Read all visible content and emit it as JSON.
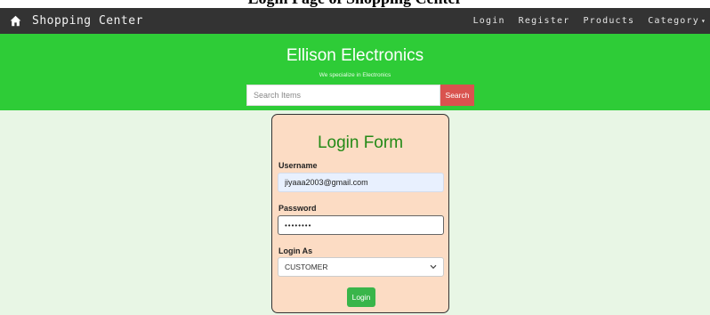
{
  "caption": {
    "text": "Login Page of Shopping Center"
  },
  "navbar": {
    "brand": "Shopping Center",
    "brand_icon": "home-icon",
    "links": [
      "Login",
      "Register",
      "Products",
      "Category"
    ],
    "dropdown_caret": "▾",
    "background": "#333333"
  },
  "header": {
    "title": "Ellison Electronics",
    "subtitle": "We specialize in Electronics",
    "background": "#2ecc37"
  },
  "search": {
    "placeholder": "Search Items",
    "button_label": "Search",
    "button_color": "#d9534f"
  },
  "login_form": {
    "title": "Login Form",
    "title_color": "#248a17",
    "card_background": "#fcdcc4",
    "username_label": "Username",
    "username_value": "jiyaaa2003@gmail.com",
    "password_label": "Password",
    "password_value": "••••••••",
    "role_label": "Login As",
    "role_value": "CUSTOMER",
    "submit_label": "Login",
    "submit_color": "#39b54a"
  },
  "page_background": "#e8f6e5"
}
